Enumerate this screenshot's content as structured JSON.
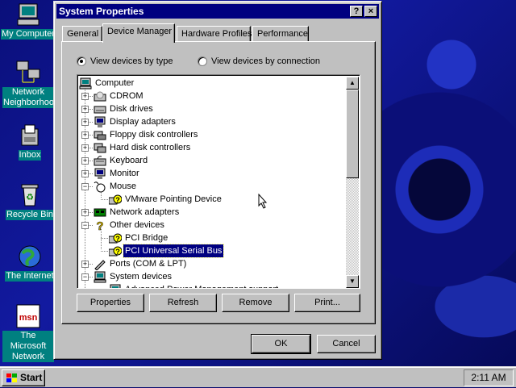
{
  "desktop": {
    "icons": [
      {
        "label": "My Computer",
        "icon": "computer-icon"
      },
      {
        "label": "Network Neighborhood",
        "icon": "network-icon"
      },
      {
        "label": "Inbox",
        "icon": "inbox-icon"
      },
      {
        "label": "Recycle Bin",
        "icon": "recycle-bin-icon"
      },
      {
        "label": "The Internet",
        "icon": "internet-icon"
      },
      {
        "label": "The Microsoft Network",
        "icon": "msn-icon"
      }
    ]
  },
  "dialog": {
    "title": "System Properties",
    "title_buttons": {
      "help": "?",
      "close": "×"
    },
    "tabs": [
      {
        "label": "General",
        "active": false
      },
      {
        "label": "Device Manager",
        "active": true
      },
      {
        "label": "Hardware Profiles",
        "active": false
      },
      {
        "label": "Performance",
        "active": false
      }
    ],
    "view_options": {
      "by_type": {
        "label": "View devices by type",
        "checked": true
      },
      "by_connection": {
        "label": "View devices by connection",
        "checked": false
      }
    },
    "tree": [
      {
        "label": "Computer",
        "icon": "computer-icon",
        "level": 0,
        "expander": ""
      },
      {
        "label": "CDROM",
        "icon": "cdrom-icon",
        "level": 1,
        "expander": "+"
      },
      {
        "label": "Disk drives",
        "icon": "disk-drive-icon",
        "level": 1,
        "expander": "+"
      },
      {
        "label": "Display adapters",
        "icon": "display-adapter-icon",
        "level": 1,
        "expander": "+"
      },
      {
        "label": "Floppy disk controllers",
        "icon": "floppy-controller-icon",
        "level": 1,
        "expander": "+"
      },
      {
        "label": "Hard disk controllers",
        "icon": "hard-disk-controller-icon",
        "level": 1,
        "expander": "+"
      },
      {
        "label": "Keyboard",
        "icon": "keyboard-icon",
        "level": 1,
        "expander": "+"
      },
      {
        "label": "Monitor",
        "icon": "monitor-icon",
        "level": 1,
        "expander": "+"
      },
      {
        "label": "Mouse",
        "icon": "mouse-icon",
        "level": 1,
        "expander": "-"
      },
      {
        "label": "VMware Pointing Device",
        "icon": "unknown-device-icon",
        "level": 2,
        "expander": ""
      },
      {
        "label": "Network adapters",
        "icon": "network-adapter-icon",
        "level": 1,
        "expander": "+"
      },
      {
        "label": "Other devices",
        "icon": "question-icon",
        "level": 1,
        "expander": "-"
      },
      {
        "label": "PCI Bridge",
        "icon": "unknown-device-icon",
        "level": 2,
        "expander": ""
      },
      {
        "label": "PCI Universal Serial Bus",
        "icon": "unknown-device-icon",
        "level": 2,
        "expander": "",
        "selected": true
      },
      {
        "label": "Ports (COM & LPT)",
        "icon": "port-icon",
        "level": 1,
        "expander": "+"
      },
      {
        "label": "System devices",
        "icon": "computer-icon",
        "level": 1,
        "expander": "-"
      },
      {
        "label": "Advanced Power Management support",
        "icon": "computer-icon",
        "level": 2,
        "expander": ""
      }
    ],
    "buttons": {
      "properties": "Properties",
      "refresh": "Refresh",
      "remove": "Remove",
      "print": "Print...",
      "ok": "OK",
      "cancel": "Cancel"
    }
  },
  "taskbar": {
    "start_label": "Start",
    "clock": "2:11 AM"
  },
  "colors": {
    "titlebar": "#000080",
    "face": "#c0c0c0",
    "selection": "#000080",
    "desktop_label_bg": "#008080"
  }
}
